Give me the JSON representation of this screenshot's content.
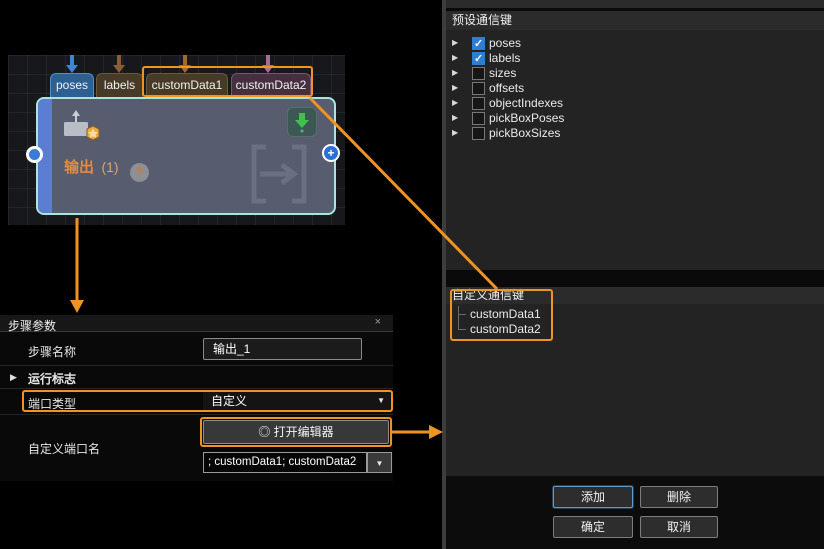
{
  "colors": {
    "accent_orange": "#EF9322",
    "checked_blue": "#2D7DD2",
    "node_border_teal": "#A8E6DC",
    "node_title_orange": "#E68A3E",
    "focus_button_blue": "#5B9BD5"
  },
  "node_editor": {
    "ports": [
      {
        "label": "poses"
      },
      {
        "label": "labels"
      },
      {
        "label": "customData1"
      },
      {
        "label": "customData2"
      }
    ],
    "node": {
      "title": "输出",
      "instance": "(1)",
      "help_badge": "?"
    },
    "plus_port_glyph": "+"
  },
  "params_panel": {
    "title": "步骤参数",
    "close_glyph": "×",
    "step_name_label": "步骤名称",
    "step_name_value": "输出_1",
    "run_flag_label": "运行标志",
    "port_type_label": "端口类型",
    "port_type_value": "自定义",
    "custom_port_name_label": "自定义端口名",
    "open_editor_icon_glyph": "◎",
    "open_editor_label": "打开编辑器",
    "custom_ports_value": "; customData1; customData2",
    "caret_glyph": "▼",
    "expander_glyph": "▶"
  },
  "keys_dialog": {
    "preset_header": "预设通信键",
    "preset_items": [
      {
        "label": "poses",
        "checked": true
      },
      {
        "label": "labels",
        "checked": true
      },
      {
        "label": "sizes",
        "checked": false
      },
      {
        "label": "offsets",
        "checked": false
      },
      {
        "label": "objectIndexes",
        "checked": false
      },
      {
        "label": "pickBoxPoses",
        "checked": false
      },
      {
        "label": "pickBoxSizes",
        "checked": false
      }
    ],
    "expander_glyph": "▶",
    "custom_header": "自定义通信键",
    "custom_items": [
      {
        "label": "customData1"
      },
      {
        "label": "customData2"
      }
    ],
    "buttons": {
      "add": "添加",
      "delete": "删除",
      "confirm": "确定",
      "cancel": "取消"
    }
  }
}
